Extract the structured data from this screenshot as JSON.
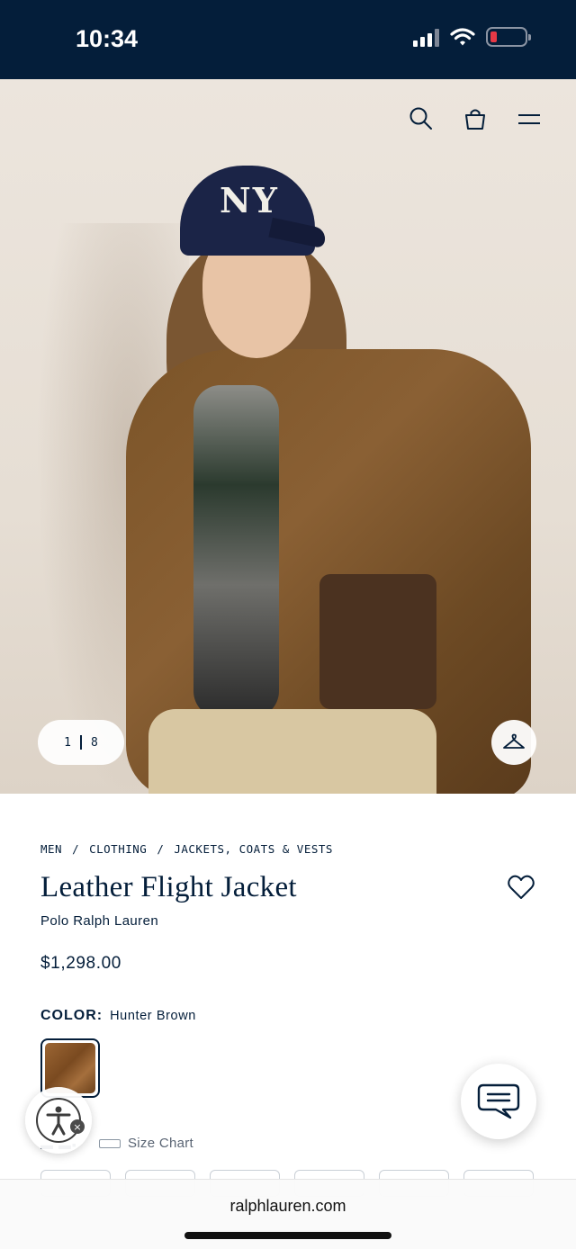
{
  "status_bar": {
    "time": "10:34",
    "background_color": "#041e3a",
    "icons": [
      "cellular-signal-icon",
      "wifi-icon",
      "battery-low-icon"
    ]
  },
  "header_icons": [
    "search-icon",
    "shopping-bag-icon",
    "menu-icon"
  ],
  "gallery": {
    "current": "1",
    "total": "8",
    "cap_logo": "NY",
    "try_on_icon": "hanger-icon"
  },
  "breadcrumb": [
    "MEN",
    "/",
    "CLOTHING",
    "/",
    "JACKETS, COATS & VESTS"
  ],
  "product": {
    "title": "Leather Flight Jacket",
    "brand": "Polo Ralph Lauren",
    "price": "$1,298.00",
    "color_label": "COLOR:",
    "color_value": "Hunter Brown",
    "wishlist_icon": "heart-outline-icon"
  },
  "size": {
    "size_chart_label": "Size Chart",
    "size_chart_icon": "ruler-icon"
  },
  "floating": {
    "accessibility_icon": "accessibility-icon",
    "chat_icon": "chat-bubble-icon"
  },
  "browser": {
    "url": "ralphlauren.com"
  },
  "colors": {
    "navy": "#041e3a",
    "swatch_brown": "#8a5a2c"
  }
}
